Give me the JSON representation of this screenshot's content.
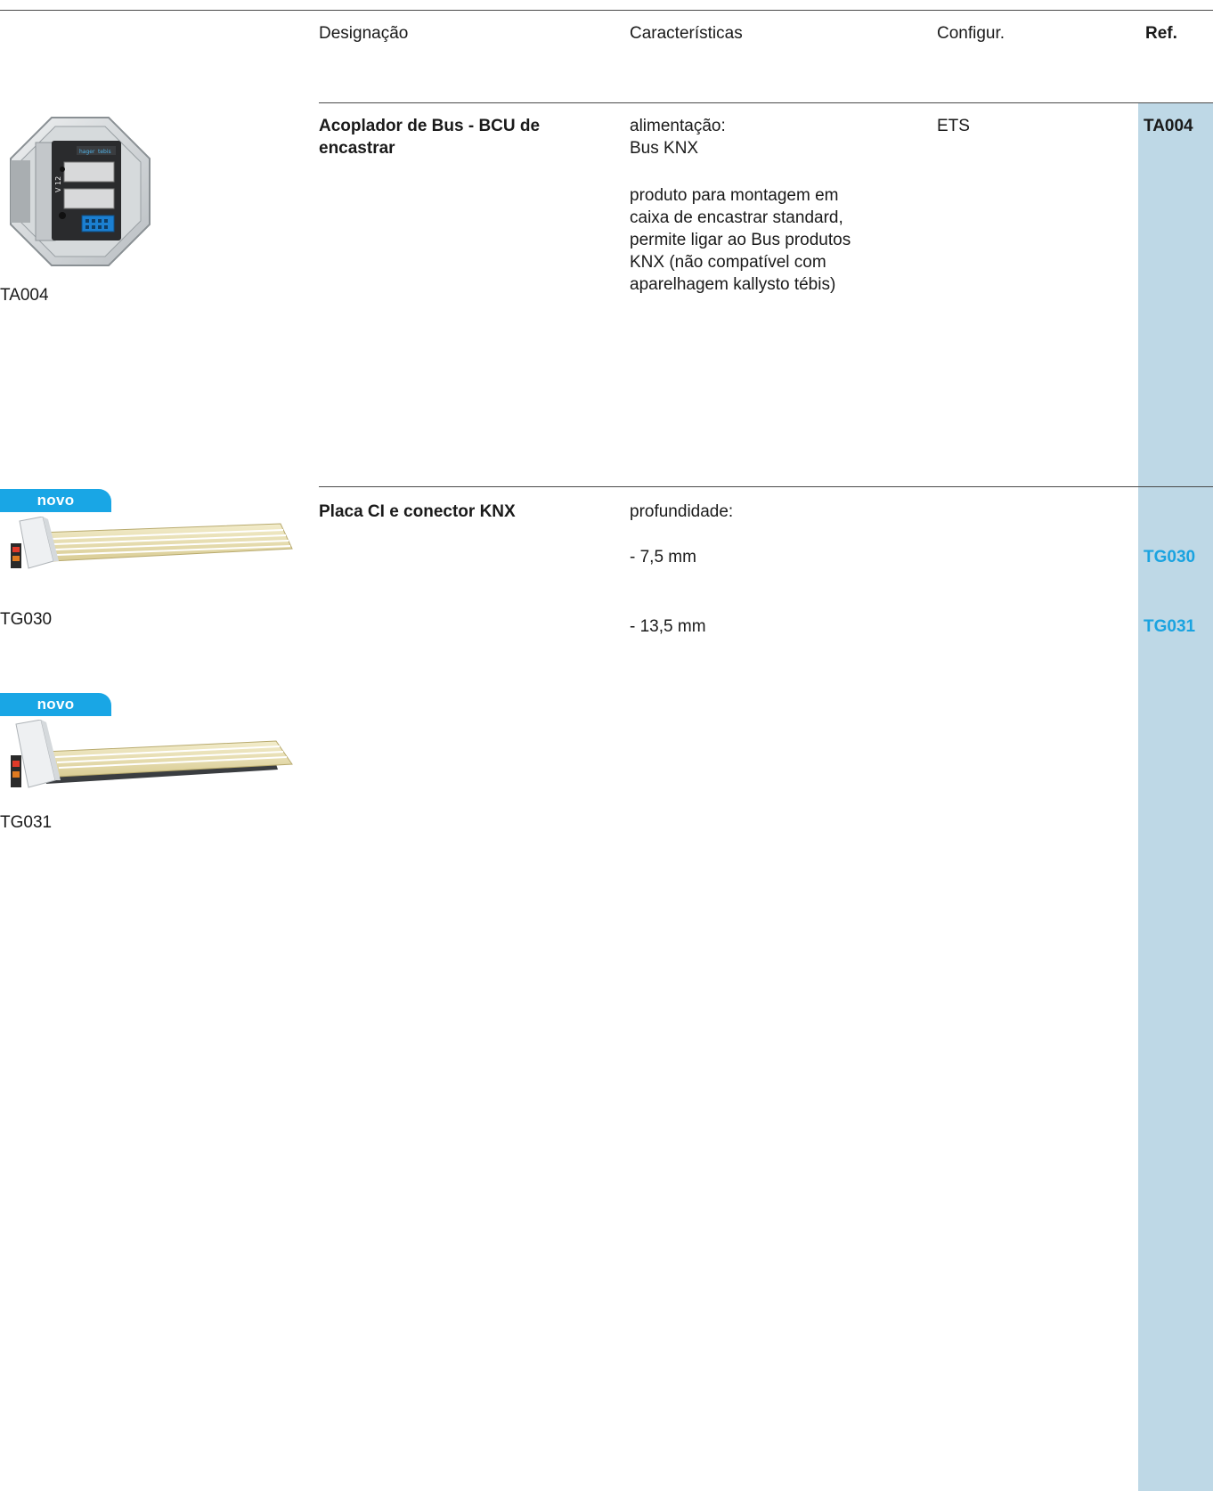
{
  "header": {
    "designation": "Designação",
    "characteristics": "Características",
    "config": "Configur.",
    "ref": "Ref."
  },
  "products": [
    {
      "image_label": "TA004",
      "designation_lines": [
        "Acoplador de Bus - BCU de",
        "encastrar"
      ],
      "char_lines_1": [
        "alimentação:",
        "Bus KNX"
      ],
      "char_lines_2": [
        "produto para montagem em",
        "caixa de encastrar standard,",
        "permite ligar ao Bus produtos",
        "KNX (não compatível com",
        "aparelhagem kallysto tébis)"
      ],
      "config": "ETS",
      "ref": "TA004",
      "device_text": {
        "brand_left": "hager",
        "brand_right": "tebis",
        "model": "V 12"
      }
    },
    {
      "badge": "novo",
      "image_label": "TG030",
      "designation": "Placa CI e conector KNX",
      "char_title": "profundidade:",
      "variants": [
        {
          "char": "- 7,5 mm",
          "ref": "TG030"
        },
        {
          "char": "- 13,5 mm",
          "ref": "TG031"
        }
      ]
    },
    {
      "badge": "novo",
      "image_label": "TG031"
    }
  ],
  "colors": {
    "ref_column": "#bed8e6",
    "accent_blue": "#1aa3e0",
    "badge_blue": "#19a6e5",
    "rule": "#4a4a4a"
  }
}
